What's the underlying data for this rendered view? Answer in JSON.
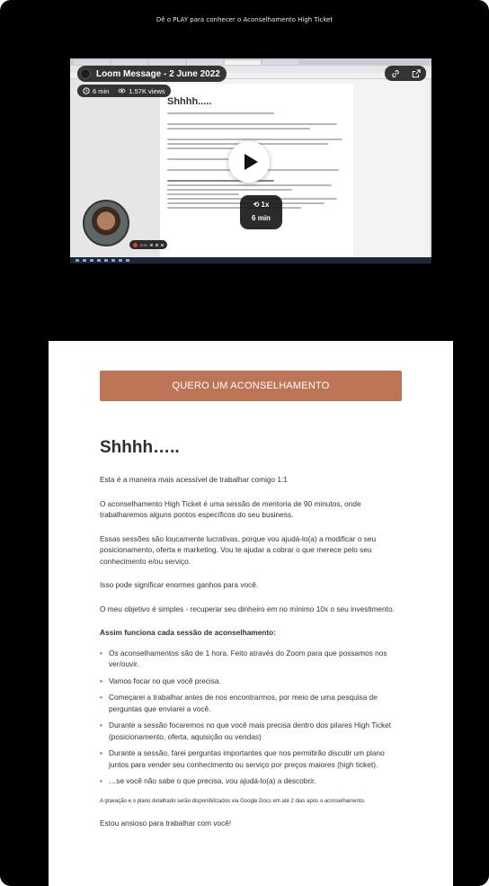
{
  "top_caption": "Dê o PLAY para conhecer o Aconselhamento High Ticket",
  "video": {
    "title": "Loom Message - 2 June 2022",
    "duration": "6 min",
    "views": "1.57K views",
    "speed": "1x",
    "speed_duration": "6 min",
    "doc_title": "Shhhh.....",
    "rec_time": "0:00",
    "icons": [
      "clock-icon",
      "eye-icon",
      "link-icon",
      "external-link-icon",
      "play-icon",
      "speed-icon"
    ]
  },
  "cta": {
    "label": "QUERO UM ACONSELHAMENTO",
    "color": "#bd7557"
  },
  "content": {
    "title": "Shhhh…..",
    "p1": "Esta é a maneira mais acessível de trabalhar comigo 1:1",
    "p2": "O aconselhamento High Ticket é uma sessão de mentoria de 90 minutos, onde trabalharemos alguns pontos específicos do seu business.",
    "p3": "Essas sessões são loucamente lucrativas, porque vou ajudá-lo(a) a modificar o seu posicionamento, oferta e marketing. Vou te ajudar a cobrar o que merece pelo seu conhecimento e/ou serviço.",
    "p4": "Isso pode significar enormes ganhos para você.",
    "p5": "O meu objetivo é simples - recuperar seu dinheiro em no mínimo 10x o seu investimento.",
    "list_heading": "Assim funciona cada sessão de aconselhamento:",
    "bullets": [
      "Os aconselhamentos são de 1 hora. Feito através do Zoom para que possamos nos ver/ouvir.",
      "Vamos focar no que você precisa.",
      "Começarei a trabalhar antes de nos encontrarmos, por meio de uma pesquisa de perguntas que enviarei a você.",
      "Durante a sessão focaremos no que você mais precisa dentro dos pilares High Ticket (posicionamento, oferta, aquisição ou vendas)",
      "Durante a sessão, farei perguntas importantes que nos permitirão discutir um plano juntos para vender seu conhecimento ou serviço por preços maiores (high ticket).",
      "…se você não sabe o que precisa, vou ajudá-lo(a) a descobrir."
    ],
    "small_note": "A gravação e o plano detalhado serão disponibilizados via Google Docs em até 2 dias após o aconselhamento.",
    "closing": "Estou ansioso para trabalhar com você!"
  }
}
